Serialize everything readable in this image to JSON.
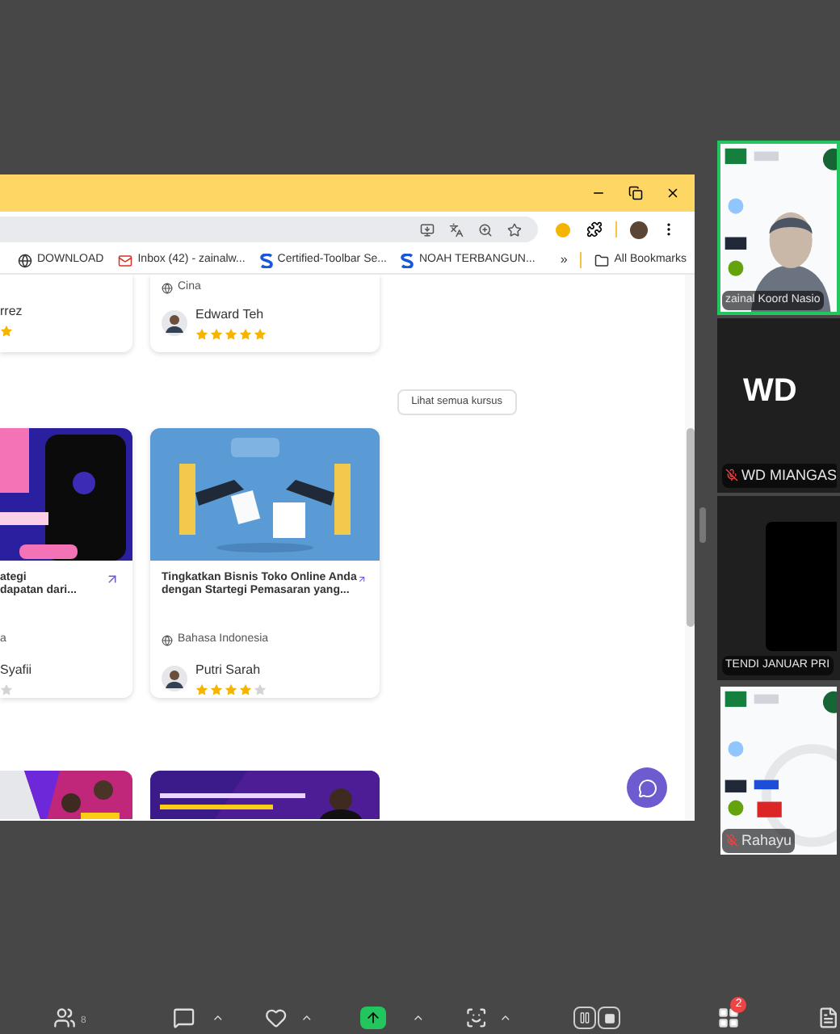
{
  "bookmarks": [
    {
      "label": "DOWNLOAD",
      "kind": "globe"
    },
    {
      "label": "Inbox (42) - zainalw...",
      "kind": "mail"
    },
    {
      "label": "Certified-Toolbar Se...",
      "kind": "site"
    },
    {
      "label": "NOAH TERBANGUN...",
      "kind": "site"
    }
  ],
  "bookmarks_more": "»",
  "all_bookmarks": "All Bookmarks",
  "top_cards": [
    {
      "kind": "clipped",
      "author": "rrez",
      "color": "#f5b400"
    },
    {
      "kind": "full",
      "language": "Cina",
      "author": "Edward Teh",
      "stars": 5
    }
  ],
  "see_all": "Lihat semua kursus",
  "course_cards": [
    {
      "kind": "clipped",
      "title_lines": [
        "ategi",
        "dapatan dari..."
      ],
      "language": "a",
      "author": "Syafii",
      "color": "#d4d4d4"
    },
    {
      "kind": "full",
      "title_lines": [
        "Tingkatkan Bisnis Toko Online Anda",
        "dengan Startegi Pemasaran yang..."
      ],
      "language": "Bahasa Indonesia",
      "author": "Putri Sarah",
      "stars": 4
    }
  ],
  "bottom_cards": [
    {
      "kind": "clipped"
    },
    {
      "kind": "full"
    }
  ],
  "participants": [
    {
      "kind": "video",
      "name": "zainal Koord Nasio",
      "muted": false,
      "speaking": true
    },
    {
      "kind": "name",
      "display": "WD",
      "name": "WD MIANGAS",
      "muted": true,
      "speaking": false
    },
    {
      "kind": "dark",
      "name": "TENDI JANUAR PRI",
      "muted": false,
      "speaking": false
    },
    {
      "kind": "logos",
      "name": "Rahayu",
      "muted": true,
      "speaking": false
    }
  ],
  "toolbar": {
    "participant_count": "8",
    "apps_badge": "2"
  }
}
